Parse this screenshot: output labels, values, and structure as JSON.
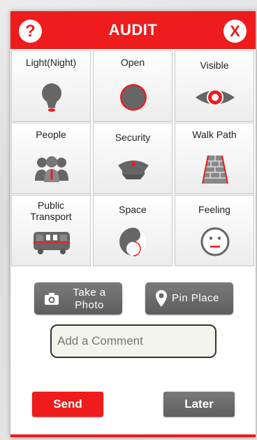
{
  "header": {
    "title": "AUDIT",
    "help_label": "?",
    "close_label": "X"
  },
  "categories": [
    {
      "label": "Light(Night)",
      "icon": "lightbulb-icon"
    },
    {
      "label": "Open",
      "icon": "open-circle-icon"
    },
    {
      "label": "Visible",
      "icon": "eye-icon"
    },
    {
      "label": "People",
      "icon": "people-icon"
    },
    {
      "label": "Security",
      "icon": "security-cap-icon"
    },
    {
      "label": "Walk Path",
      "icon": "walk-path-icon"
    },
    {
      "label": "Public\nTransport",
      "icon": "bus-icon"
    },
    {
      "label": "Space",
      "icon": "yin-yang-icon"
    },
    {
      "label": "Feeling",
      "icon": "face-icon"
    }
  ],
  "actions": {
    "photo_label": "Take a\nPhoto",
    "pin_label": "Pin Place",
    "comment_placeholder": "Add a Comment",
    "send_label": "Send",
    "later_label": "Later"
  },
  "colors": {
    "accent": "#ee1c1c",
    "icon_gray": "#666666",
    "button_gray": "#6c6c6c"
  }
}
